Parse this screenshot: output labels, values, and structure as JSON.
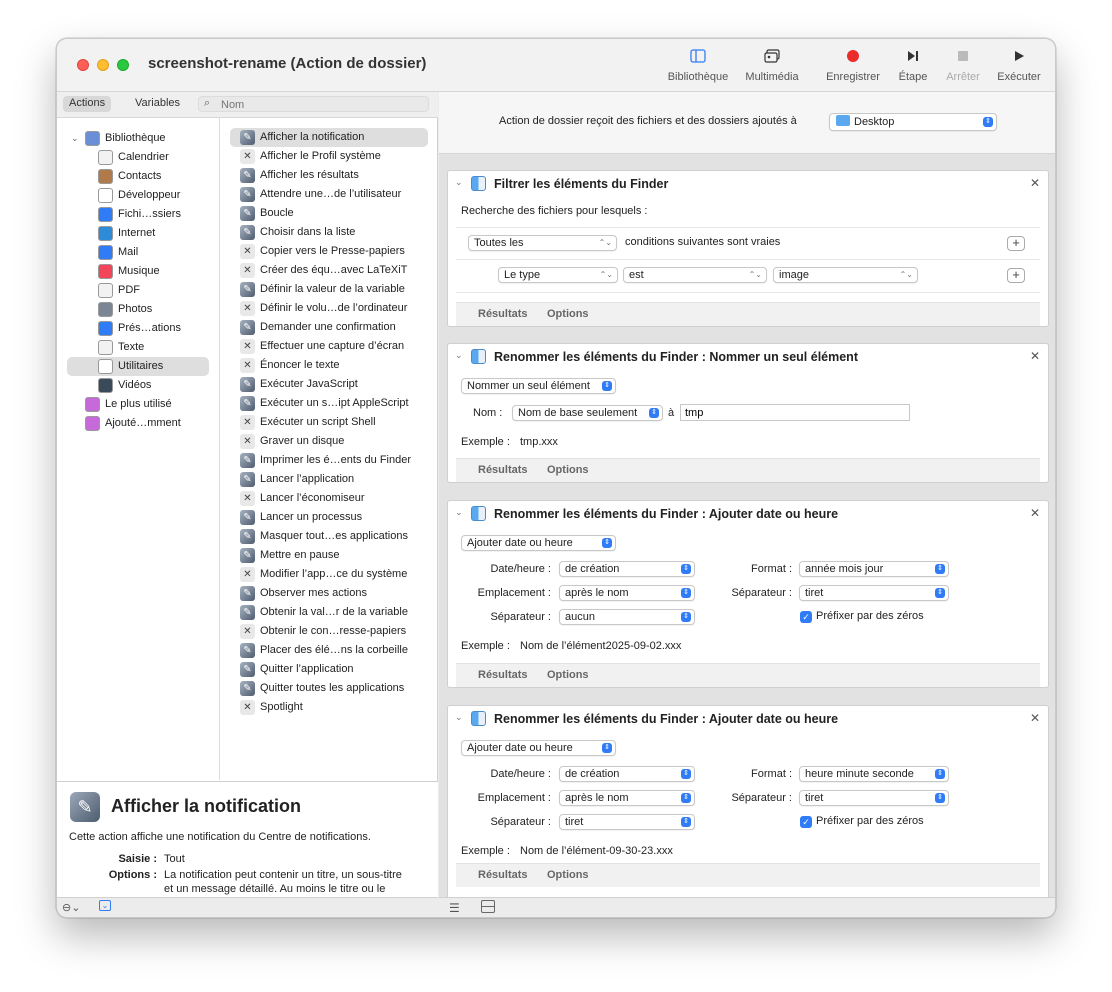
{
  "window": {
    "title": "screenshot-rename (Action de dossier)"
  },
  "toolbar": {
    "bibliotheque": "Bibliothèque",
    "multimedia": "Multimédia",
    "enregistrer": "Enregistrer",
    "etape": "Étape",
    "arreter": "Arrêter",
    "executer": "Exécuter"
  },
  "library": {
    "tab_actions": "Actions",
    "tab_variables": "Variables",
    "search_placeholder": "Nom",
    "categories": [
      {
        "label": "Bibliothèque",
        "icon": "library-icon",
        "color": "#6b8fd6"
      },
      {
        "label": "Calendrier",
        "icon": "calendar-icon",
        "color": "#f2f2f2"
      },
      {
        "label": "Contacts",
        "icon": "contacts-icon",
        "color": "#b07a4a"
      },
      {
        "label": "Développeur",
        "icon": "developer-icon",
        "color": "#ffffff"
      },
      {
        "label": "Fichi…ssiers",
        "icon": "finder-icon",
        "color": "#2f7cf6"
      },
      {
        "label": "Internet",
        "icon": "globe-icon",
        "color": "#2e8bd8"
      },
      {
        "label": "Mail",
        "icon": "mail-icon",
        "color": "#2f7cf6"
      },
      {
        "label": "Musique",
        "icon": "music-icon",
        "color": "#f2455a"
      },
      {
        "label": "PDF",
        "icon": "pdf-icon",
        "color": "#f2f2f2"
      },
      {
        "label": "Photos",
        "icon": "photos-icon",
        "color": "#7a8694"
      },
      {
        "label": "Prés…ations",
        "icon": "keynote-icon",
        "color": "#2f7cf6"
      },
      {
        "label": "Texte",
        "icon": "text-icon",
        "color": "#f2f2f2"
      },
      {
        "label": "Utilitaires",
        "icon": "utilities-icon",
        "color": "#ffffff"
      },
      {
        "label": "Vidéos",
        "icon": "video-icon",
        "color": "#3a4a5a"
      },
      {
        "label": "Le plus utilisé",
        "icon": "smart-folder-icon",
        "color": "#c56ad8"
      },
      {
        "label": "Ajouté…mment",
        "icon": "smart-folder-icon",
        "color": "#c56ad8"
      }
    ],
    "actions": [
      "Afficher la notification",
      "Afficher le Profil système",
      "Afficher les résultats",
      "Attendre une…de l’utilisateur",
      "Boucle",
      "Choisir dans la liste",
      "Copier vers le Presse-papiers",
      "Créer des équ…avec LaTeXiT",
      "Définir la valeur de la variable",
      "Définir le volu…de l’ordinateur",
      "Demander une confirmation",
      "Effectuer une capture d’écran",
      "Énoncer le texte",
      "Exécuter JavaScript",
      "Exécuter un s…ipt AppleScript",
      "Exécuter un script Shell",
      "Graver un disque",
      "Imprimer les é…ents du Finder",
      "Lancer l’application",
      "Lancer l’économiseur",
      "Lancer un processus",
      "Masquer tout…es applications",
      "Mettre en pause",
      "Modifier l’app…ce du système",
      "Observer mes actions",
      "Obtenir la val…r de la variable",
      "Obtenir le con…resse-papiers",
      "Placer des élé…ns la corbeille",
      "Quitter l’application",
      "Quitter toutes les applications",
      "Spotlight"
    ],
    "description": {
      "title": "Afficher la notification",
      "text": "Cette action affiche une notification du Centre de notifications.",
      "saisie_label": "Saisie :",
      "saisie_value": "Tout",
      "options_label": "Options :",
      "options_line1": "La notification peut contenir un titre, un sous-titre",
      "options_line2": "et un message détaillé. Au moins le titre ou le"
    }
  },
  "workflow": {
    "receive_label": "Action de dossier reçoit des fichiers et des dossiers ajoutés à",
    "receive_folder": "Desktop",
    "card1": {
      "title": "Filtrer les éléments du Finder",
      "search_label": "Recherche des fichiers pour lesquels :",
      "match_popup": "Toutes les",
      "match_suffix": "conditions suivantes sont vraies",
      "cond_field": "Le type",
      "cond_op": "est",
      "cond_value": "image",
      "results": "Résultats",
      "options": "Options"
    },
    "card2": {
      "title": "Renommer les éléments du Finder : Nommer un seul élément",
      "mode": "Nommer un seul élément",
      "nom_label": "Nom :",
      "nom_popup": "Nom de base seulement",
      "a_label": "à",
      "nom_value": "tmp",
      "example_label": "Exemple :",
      "example_value": "tmp.xxx",
      "results": "Résultats",
      "options": "Options"
    },
    "card3": {
      "title": "Renommer les éléments du Finder : Ajouter date ou heure",
      "mode": "Ajouter date ou heure",
      "dateheure_label": "Date/heure :",
      "dateheure_value": "de création",
      "format_label": "Format :",
      "format_value": "année mois jour",
      "emplacement_label": "Emplacement :",
      "emplacement_value": "après le nom",
      "separateur_r_label": "Séparateur :",
      "separateur_r_value": "tiret",
      "separateur_l_label": "Séparateur :",
      "separateur_l_value": "aucun",
      "prefix_label": "Préfixer par des zéros",
      "example_label": "Exemple :",
      "example_value": "Nom de l’élément2025-09-02.xxx",
      "results": "Résultats",
      "options": "Options"
    },
    "card4": {
      "title": "Renommer les éléments du Finder : Ajouter date ou heure",
      "mode": "Ajouter date ou heure",
      "dateheure_label": "Date/heure :",
      "dateheure_value": "de création",
      "format_label": "Format :",
      "format_value": "heure minute seconde",
      "emplacement_label": "Emplacement :",
      "emplacement_value": "après le nom",
      "separateur_r_label": "Séparateur :",
      "separateur_r_value": "tiret",
      "separateur_l_label": "Séparateur :",
      "separateur_l_value": "tiret",
      "prefix_label": "Préfixer par des zéros",
      "example_label": "Exemple :",
      "example_value": "Nom de l’élément-09-30-23.xxx",
      "results": "Résultats",
      "options": "Options"
    }
  }
}
